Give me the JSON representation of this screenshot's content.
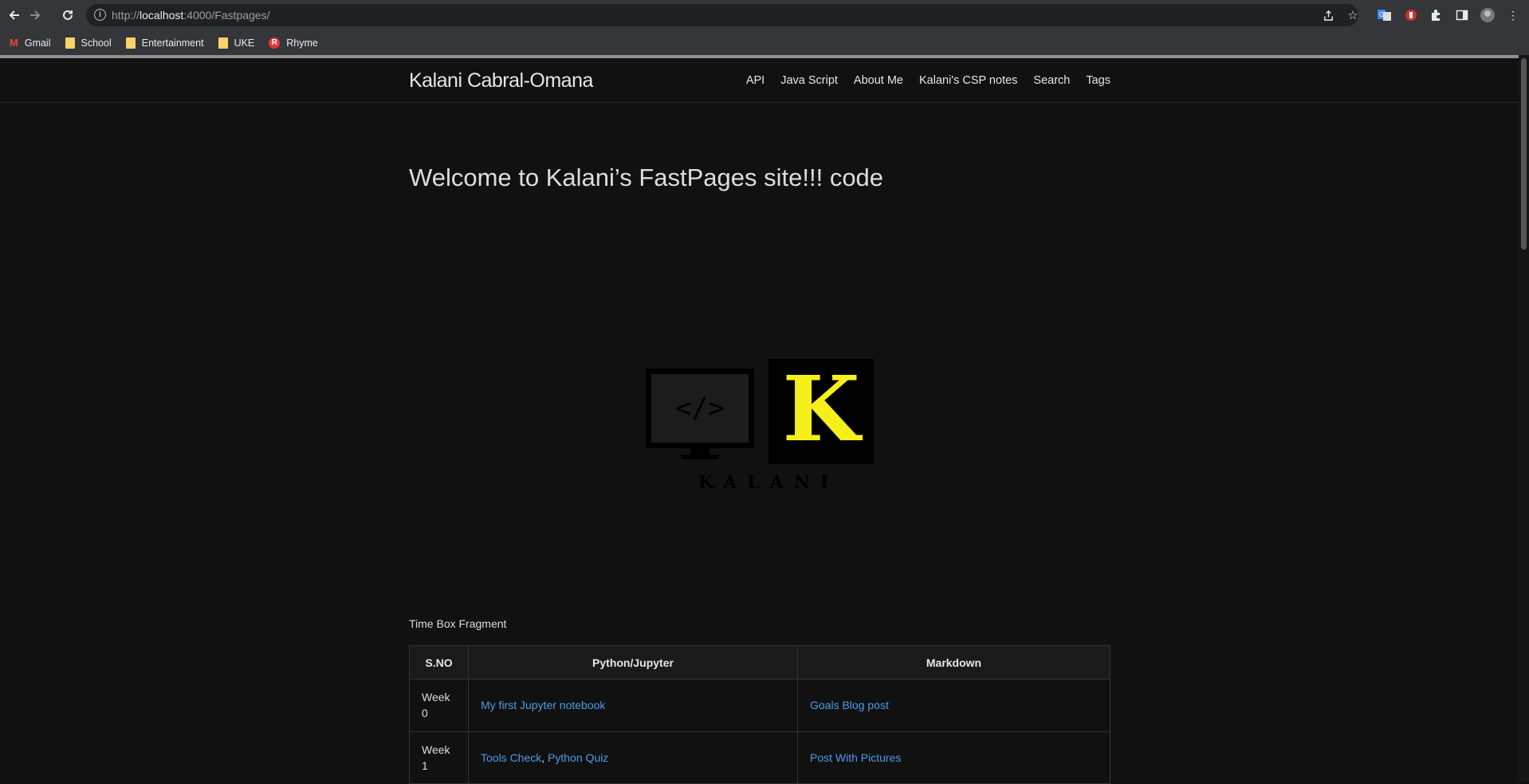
{
  "browser": {
    "url_prefix": "http://",
    "url_host": "localhost",
    "url_rest": ":4000/Fastpages/",
    "bookmarks": [
      {
        "label": "Gmail",
        "icon": "gmail-icon"
      },
      {
        "label": "School",
        "icon": "folder-icon"
      },
      {
        "label": "Entertainment",
        "icon": "folder-icon"
      },
      {
        "label": "UKE",
        "icon": "folder-icon"
      },
      {
        "label": "Rhyme",
        "icon": "rhyme-icon"
      }
    ]
  },
  "site": {
    "title": "Kalani Cabral-Omana",
    "nav": [
      "API",
      "Java Script",
      "About Me",
      "Kalani's CSP notes",
      "Search",
      "Tags"
    ]
  },
  "main": {
    "heading": "Welcome to Kalani’s FastPages site!!! code",
    "logo": {
      "code_symbol": "</>",
      "letter": "K",
      "text": "KALANI",
      "accent_color": "#f5ef1c"
    },
    "caption": "Time Box Fragment",
    "table": {
      "headers": [
        "S.NO",
        "Python/Jupyter",
        "Markdown"
      ],
      "rows": [
        {
          "week": "Week 0",
          "python": [
            "My first Jupyter notebook"
          ],
          "markdown": "Goals Blog post"
        },
        {
          "week": "Week 1",
          "python": [
            "Tools Check",
            "Python Quiz"
          ],
          "markdown": "Post With Pictures"
        }
      ]
    }
  },
  "colors": {
    "background": "#111111",
    "link": "#4c9be8",
    "chrome": "#35363a"
  }
}
